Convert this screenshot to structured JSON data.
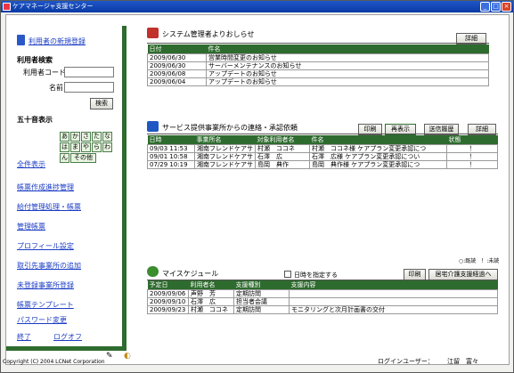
{
  "window": {
    "title": "ケアマネージャ支援センター"
  },
  "sidebar": {
    "register_link": "利用者の新規登録",
    "search_heading": "利用者検索",
    "code_label": "利用者コード",
    "name_label": "名前",
    "code_value": "",
    "name_value": "",
    "search_button": "検索",
    "kana_heading": "五十音表示",
    "kana_rows": [
      [
        "あ",
        "か",
        "さ",
        "た",
        "な"
      ],
      [
        "は",
        "ま",
        "や",
        "ら",
        "わ"
      ]
    ],
    "kana_n": "ん",
    "kana_other": "その他",
    "show_all": "全件表示",
    "menu": [
      "帳票作成進捗管理",
      "給付管理処理・帳票",
      "管理帳票",
      "プロフィール設定",
      "取引先事業所の追加",
      "未登録事業所登録",
      "帳票テンプレート",
      "パスワード変更"
    ],
    "exit": "終了",
    "logoff": "ログオフ"
  },
  "notice": {
    "title": "システム管理者よりおしらせ",
    "detail_button": "詳細",
    "columns": [
      "日付",
      "件名"
    ],
    "rows": [
      [
        "2009/06/30",
        "営業時間変更のお知らせ"
      ],
      [
        "2009/06/30",
        "サーバーメンテナンスのお知らせ"
      ],
      [
        "2009/06/08",
        "アップデートのお知らせ"
      ],
      [
        "2009/06/04",
        "アップデートのお知らせ"
      ]
    ]
  },
  "contact": {
    "title": "サービス提供事業所からの連絡・承認依頼",
    "print_button": "印刷",
    "refresh_button": "再表示",
    "history_button": "送信履歴",
    "detail_button": "詳細",
    "columns": [
      "日時",
      "事業所名",
      "対象利用者名",
      "件名",
      "状態"
    ],
    "rows": [
      [
        "09/03 11:53",
        "湘南フレンドケアサ",
        "村瀬　ココネ",
        "村瀬　ココネ様 ケアプラン変更承認につ",
        "！"
      ],
      [
        "09/01 10:58",
        "湘南フレンドケアサ",
        "石澤　広",
        "石澤　広様 ケアプラン変更承認につい",
        "！"
      ],
      [
        "07/29 10:19",
        "湘南フレンドケアサ",
        "島岡　典作",
        "島岡　典作様 ケアプラン変更承認につ",
        "！"
      ]
    ],
    "legend": "○:既読　！:未読"
  },
  "schedule": {
    "title": "マイスケジュール",
    "date_checkbox_label": "日時を指定する",
    "print_button": "印刷",
    "care_plan_button": "居宅介護支援経過へ",
    "columns": [
      "予定日",
      "利用者名",
      "支援種別",
      "支援内容"
    ],
    "rows": [
      [
        "2009/09/06",
        "声野　芳",
        "定期訪問",
        ""
      ],
      [
        "2009/09/10",
        "石澤　広",
        "担当者会議",
        ""
      ],
      [
        "2009/09/23",
        "村瀬　ココネ",
        "定期訪問",
        "モニタリングと次月計画書の交付"
      ]
    ]
  },
  "footer": {
    "copyright": "Copyright (C) 2004 LCNet Corporation",
    "login_label": "ログインユーザー：",
    "login_user": "江留　富々"
  }
}
